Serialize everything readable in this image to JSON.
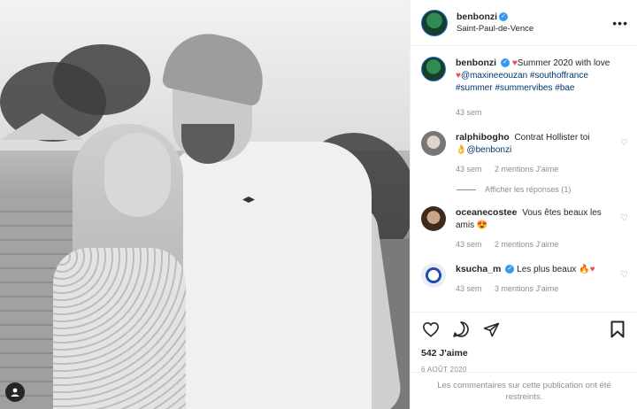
{
  "post": {
    "author": "benbonzi",
    "location": "Saint-Paul-de-Vence",
    "caption_emoji": "♥",
    "caption_text": "Summer 2020 with love",
    "caption_heart2": "♥",
    "caption_mention": "@maxineeouzan",
    "caption_tags_1": "#southoffrance",
    "caption_tags_2": "#summer #summervibes #bae",
    "caption_time": "43 sem",
    "likes": "542 J'aime",
    "date": "6 AOÛT 2020",
    "restricted_notice": "Les commentaires sur cette publication ont été restreints."
  },
  "comments": [
    {
      "user": "ralphibogho",
      "text": "Contrat Hollister toi",
      "emoji": "👌",
      "mention": "@benbonzi",
      "time": "43 sem",
      "mentions": "2 mentions J'aime",
      "replies_label": "Afficher les réponses (1)"
    },
    {
      "user": "oceanecostee",
      "text": "Vous êtes beaux les amis",
      "emoji": "😍",
      "time": "43 sem",
      "mentions": "2 mentions J'aime"
    },
    {
      "user": "ksucha_m",
      "text": "Les plus beaux",
      "emoji": "🔥♥",
      "time": "43 sem",
      "mentions": "3 mentions J'aime"
    }
  ],
  "icons": {
    "like": "heart-icon",
    "comment": "comment-icon",
    "share": "send-icon",
    "save": "bookmark-icon",
    "more": "more-options-icon",
    "tagged": "tagged-user-icon"
  },
  "colors": {
    "verified": "#3897f0",
    "link": "#00376b",
    "meta": "#8e8e8e"
  }
}
